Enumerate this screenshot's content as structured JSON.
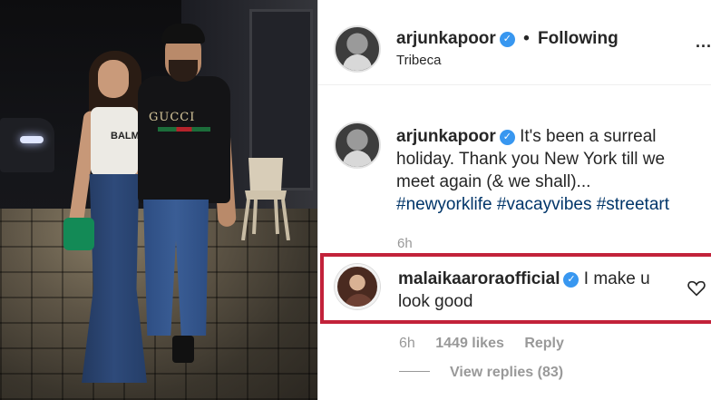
{
  "header": {
    "username": "arjunkapoor",
    "verified_mark": "✓",
    "separator": "•",
    "follow_status": "Following",
    "location": "Tribeca",
    "more_glyph": "..."
  },
  "caption": {
    "username": "arjunkapoor",
    "verified_mark": "✓",
    "text": "It's been a surreal holiday. Thank you New York till we meet again (& we shall)...",
    "hashtags": [
      "#newyorklife",
      "#vacayvibes",
      "#streetart"
    ],
    "time": "6h"
  },
  "highlighted_comment": {
    "username": "malaikaaroraofficial",
    "verified_mark": "✓",
    "text": "I make u look good",
    "time": "6h",
    "likes": "1449 likes",
    "reply_label": "Reply",
    "view_replies": "View replies (83)"
  },
  "photo": {
    "tshirt_text": "GUCCI",
    "top_text": "BALM"
  },
  "colors": {
    "highlight_border": "#c2223a",
    "verified": "#3897f0",
    "hashtag": "#003569"
  }
}
